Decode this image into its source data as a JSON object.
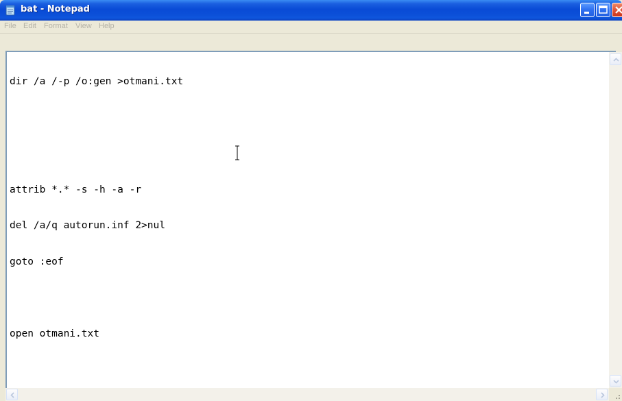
{
  "window": {
    "title": "bat - Notepad"
  },
  "menu": {
    "file": "File",
    "edit": "Edit",
    "format": "Format",
    "view": "View",
    "help": "Help"
  },
  "editor": {
    "lines": [
      "dir /a /-p /o:gen >otmani.txt",
      "",
      "",
      "attrib *.* -s -h -a -r",
      "del /a/q autorun.inf 2>nul",
      "goto :eof",
      "",
      "open otmani.txt"
    ]
  },
  "colors": {
    "titlebar": "#0a4bd6",
    "menu_text": "#b5b2a7",
    "close_button": "#e0553a"
  },
  "icons": {
    "app": "notepad-icon",
    "cursor": "text-cursor-icon"
  }
}
